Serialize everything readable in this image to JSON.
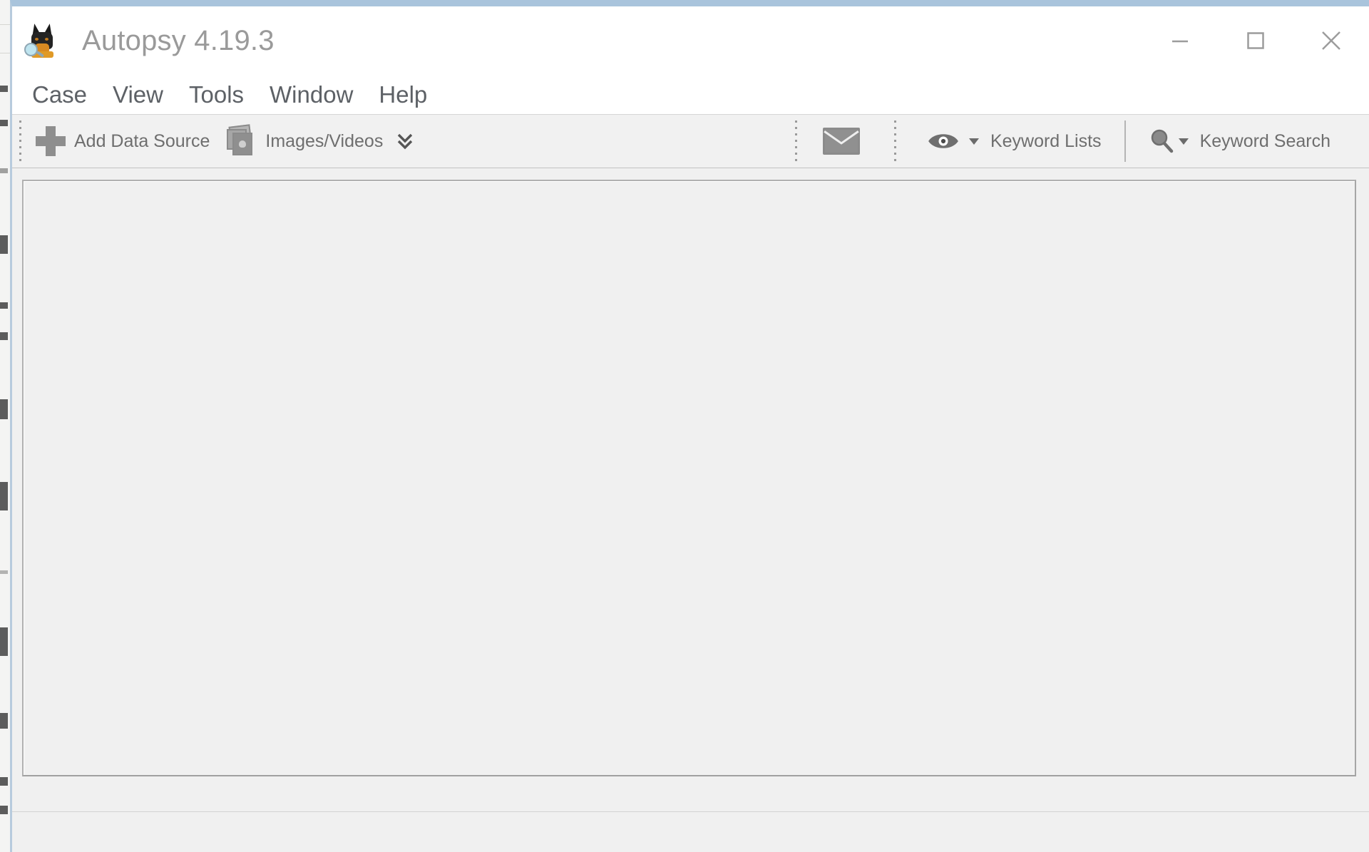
{
  "window": {
    "title": "Autopsy 4.19.3",
    "app_icon": "autopsy-doberman-magnifier-icon",
    "controls": {
      "minimize": "minimize-icon",
      "maximize": "maximize-icon",
      "close": "close-icon"
    },
    "accent_border_color": "#a9c4dc",
    "chrome_background": "#ffffff",
    "toolbar_background": "#f1f1f1",
    "content_background": "#f0f0f0"
  },
  "menu": {
    "items": [
      {
        "label": "Case"
      },
      {
        "label": "View"
      },
      {
        "label": "Tools"
      },
      {
        "label": "Window"
      },
      {
        "label": "Help"
      }
    ]
  },
  "toolbar": {
    "groups": [
      {
        "name": "data-sources",
        "buttons": [
          {
            "label": "Add Data Source",
            "icon": "plus-icon",
            "dropdown": false
          },
          {
            "label": "Images/Videos",
            "icon": "images-videos-icon",
            "dropdown": true,
            "dropdown_glyph": "double-chevron-down"
          }
        ]
      },
      {
        "name": "communications",
        "buttons": [
          {
            "label": "",
            "icon": "envelope-icon",
            "dropdown": false
          }
        ]
      },
      {
        "name": "keyword",
        "buttons": [
          {
            "label": "Keyword Lists",
            "icon": "eye-icon",
            "dropdown": true,
            "dropdown_glyph": "caret-down"
          },
          {
            "label": "Keyword Search",
            "icon": "magnifier-icon",
            "dropdown": true,
            "dropdown_glyph": "caret-down"
          }
        ]
      }
    ]
  },
  "main": {
    "content_text": "",
    "state": "empty-no-case-open"
  },
  "status_bar": {
    "text": ""
  }
}
